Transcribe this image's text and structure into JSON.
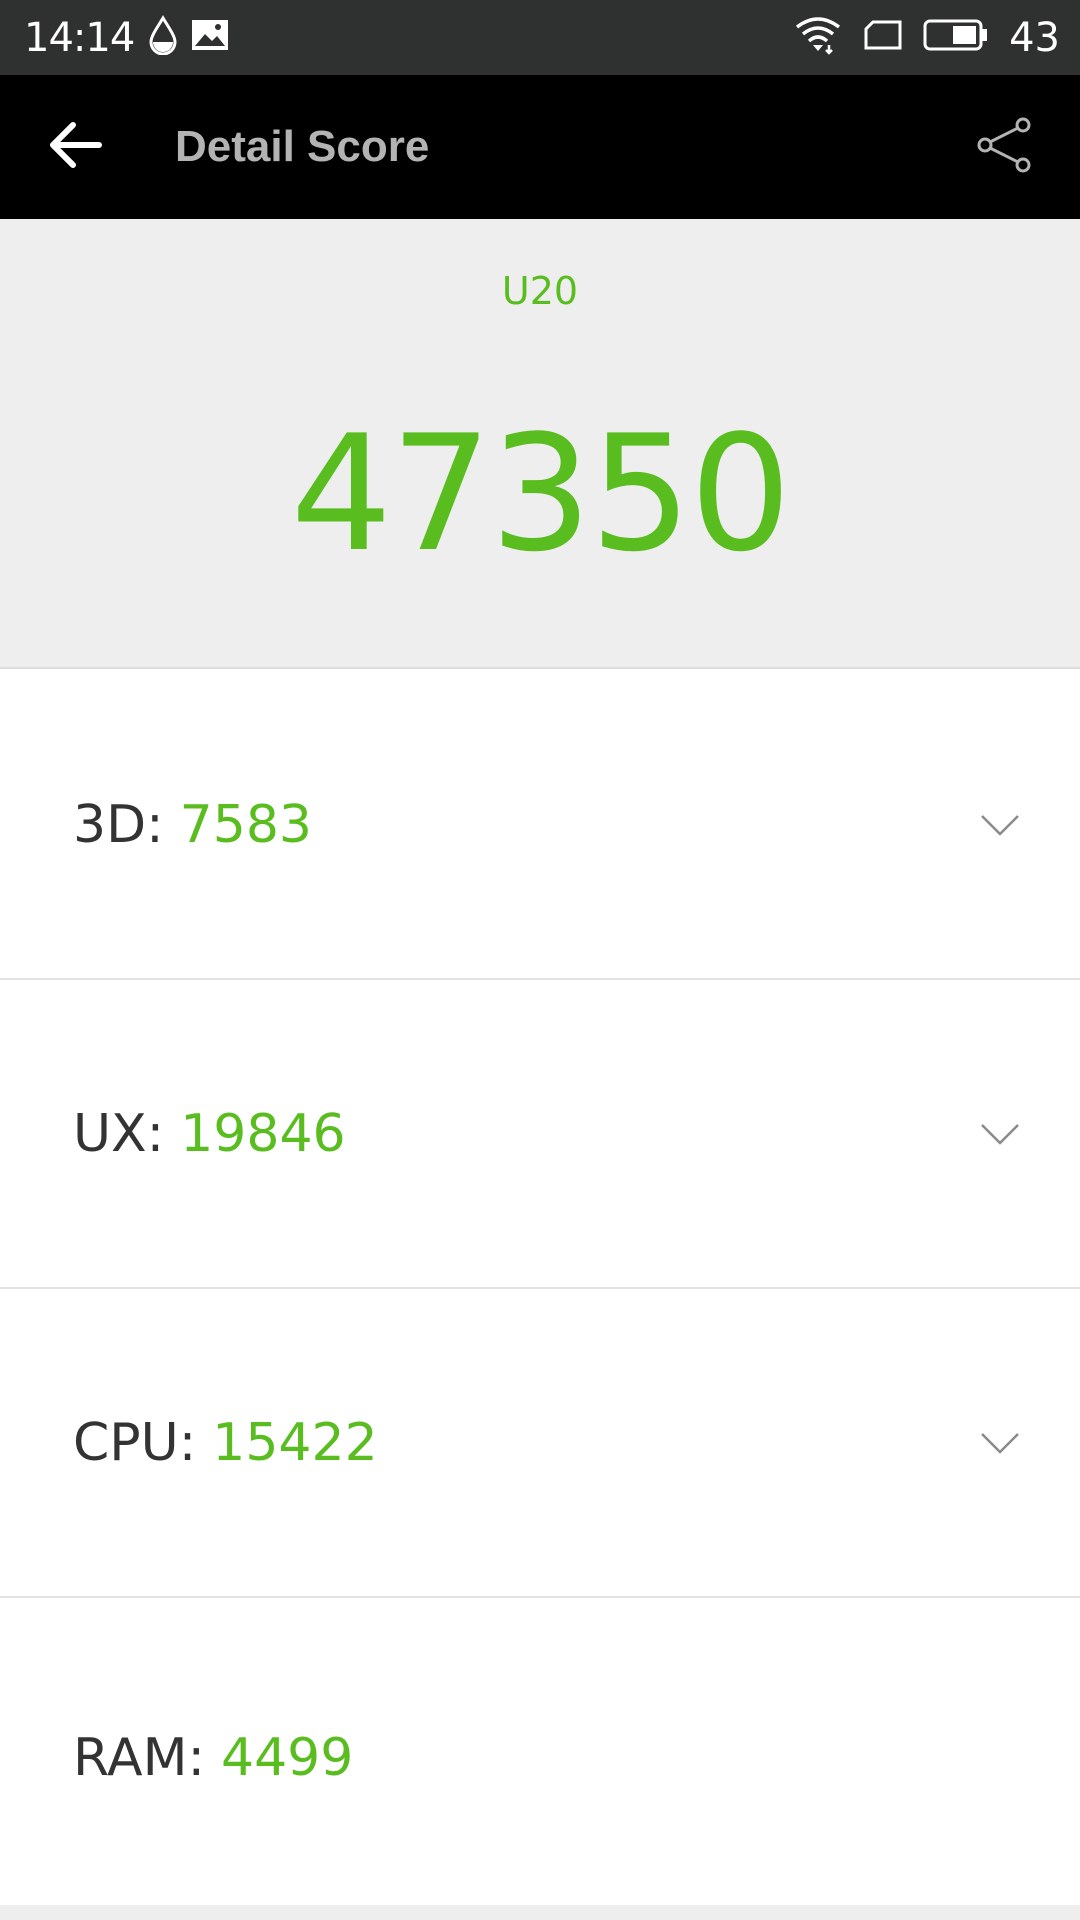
{
  "status_bar": {
    "time": "14:14",
    "battery": "43",
    "icons": [
      "drop-icon",
      "image-icon",
      "wifi-icon",
      "sim-card-icon",
      "battery-icon"
    ]
  },
  "app_bar": {
    "title": "Detail Score",
    "back_icon": "arrow-left-icon",
    "share_icon": "share-icon"
  },
  "header": {
    "device": "U20",
    "total_score": "47350"
  },
  "scores": [
    {
      "label": "3D:",
      "value": "7583",
      "expandable": true
    },
    {
      "label": "UX:",
      "value": "19846",
      "expandable": true
    },
    {
      "label": "CPU:",
      "value": "15422",
      "expandable": true
    },
    {
      "label": "RAM:",
      "value": "4499",
      "expandable": false
    }
  ],
  "colors": {
    "accent": "#5abd1f",
    "status_bar_bg": "#2f3030",
    "app_bar_bg": "#000000",
    "header_bg": "#eeeeee"
  }
}
